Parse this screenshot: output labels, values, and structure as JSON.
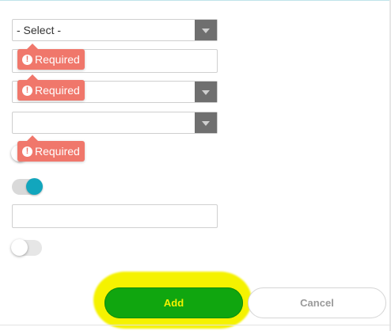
{
  "form": {
    "select_1": {
      "value": "- Select -"
    },
    "select_2": {
      "value": ""
    },
    "select_3": {
      "value": ""
    },
    "text_input_1": {
      "value": ""
    },
    "text_input_2": {
      "value": ""
    },
    "toggle_1": {
      "state": "off"
    },
    "toggle_2": {
      "state": "on"
    },
    "toggle_3": {
      "state": "off"
    },
    "validation": {
      "required_label": "Required",
      "icon": "exclamation-circle-icon",
      "color": "#f0776b"
    }
  },
  "footer": {
    "add_label": "Add",
    "cancel_label": "Cancel"
  },
  "colors": {
    "add_button_bg": "#10a60f",
    "add_button_text": "#f5f200",
    "highlight": "#f5f200",
    "toggle_on": "#12a6bd"
  }
}
